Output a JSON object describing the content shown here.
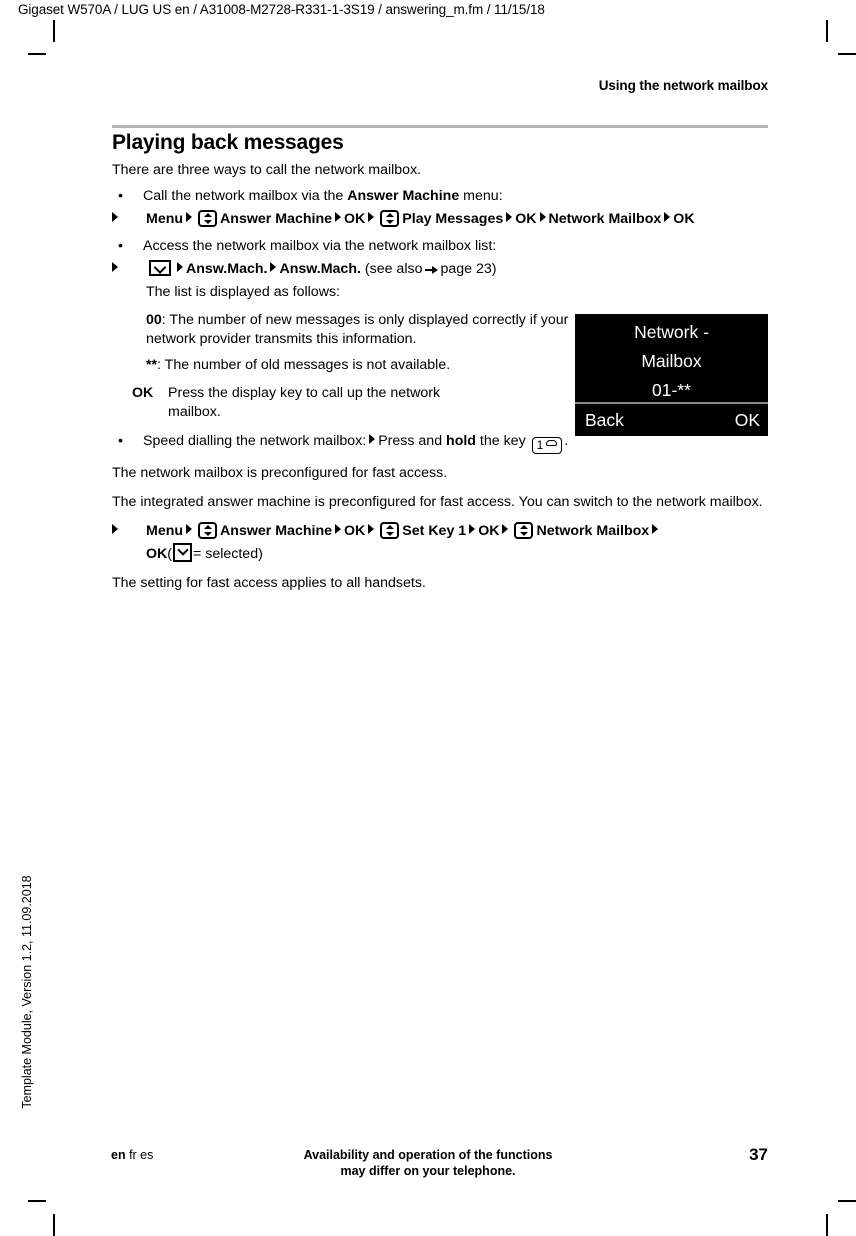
{
  "file_header": "Gigaset W570A / LUG US en / A31008-M2728-R331-1-3S19 / answering_m.fm / 11/15/18",
  "running_head": "Using the network mailbox",
  "section": {
    "title": "Playing back messages",
    "intro": "There are three ways to call the network mailbox."
  },
  "bullets": {
    "b1": {
      "text_before": "Call the network mailbox via the ",
      "bold": "Answer Machine",
      "text_after": " menu:",
      "path": {
        "menu": "Menu",
        "answer_machine": "Answer Machine",
        "ok1": "OK",
        "play_messages": "Play Messages",
        "ok2": "OK",
        "network_mailbox": "Network Mailbox",
        "ok3": "OK"
      }
    },
    "b2": {
      "text": "Access the network mailbox via the network mailbox list:",
      "path": {
        "answ_mach_1": "Answ.Mach.",
        "answ_mach_2": "Answ.Mach.",
        "see_also": "(see also",
        "page_ref": "page 23)"
      },
      "list_intro": "The list is displayed as follows:"
    },
    "b3": {
      "text_before": "Speed dialling the network mailbox:",
      "press_and": "Press and ",
      "hold": "hold",
      "text_after": " the key ",
      "key_label": "1",
      "period": "."
    }
  },
  "notes": {
    "new_code": "00",
    "new_text": ": The number of new messages is only displayed correctly if your network provider transmits this information.",
    "old_code": "**",
    "old_text": ": The number of old messages is not available.",
    "ok_term": "OK",
    "ok_desc": "Press the display key to call up the network mailbox."
  },
  "paragraphs": {
    "preconfigured": "The network mailbox is preconfigured for fast access.",
    "integrated": "The integrated answer machine is preconfigured for fast access. You can switch to the network mailbox.",
    "applies": "The setting for fast access applies to all handsets."
  },
  "final_path": {
    "menu": "Menu",
    "answer_machine": "Answer Machine",
    "ok1": "OK",
    "set_key": "Set Key 1",
    "ok2": "OK",
    "network_mailbox": "Network Mailbox",
    "ok3": "OK",
    "selected_open": "(",
    "selected_text": "= selected)"
  },
  "phone_display": {
    "line1": "Network -",
    "line2": "Mailbox",
    "line3": "01-**",
    "left_key": "Back",
    "right_key": "OK",
    "bg_color": "#000000",
    "text_color": "#ffffff"
  },
  "side_text": "Template Module, Version 1.2, 11.09.2018",
  "footer": {
    "lang_current": "en",
    "lang_others": " fr es",
    "note_line1": "Availability and operation of the functions",
    "note_line2": "may differ on your telephone.",
    "page_number": "37"
  }
}
